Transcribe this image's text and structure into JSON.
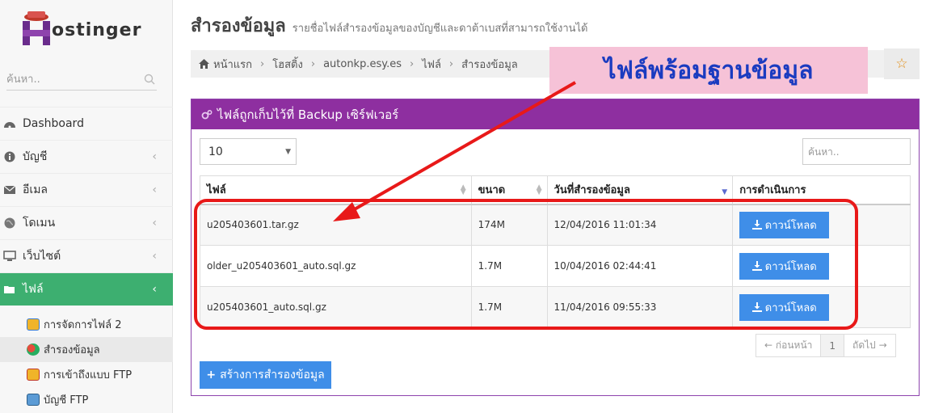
{
  "brand": {
    "name": "ostinger"
  },
  "sidebar": {
    "search_placeholder": "ค้นหา..",
    "items": [
      {
        "label": "Dashboard",
        "icon": "dashboard-icon"
      },
      {
        "label": "บัญชี",
        "icon": "info-icon"
      },
      {
        "label": "อีเมล",
        "icon": "envelope-icon"
      },
      {
        "label": "โดเมน",
        "icon": "globe-icon"
      },
      {
        "label": "เว็บไซต์",
        "icon": "monitor-icon"
      },
      {
        "label": "ไฟล์",
        "icon": "folder-icon"
      }
    ],
    "subitems": [
      {
        "label": "การจัดการไฟล์ 2"
      },
      {
        "label": "สำรองข้อมูล"
      },
      {
        "label": "การเข้าถึงแบบ FTP"
      },
      {
        "label": "บัญชี FTP"
      }
    ]
  },
  "page": {
    "title": "สำรองข้อมูล",
    "subtitle": "รายชื่อไฟล์สำรองข้อมูลของบัญชีและดาต้าเบสที่สามารถใช้งานได้"
  },
  "breadcrumb": [
    "หน้าแรก",
    "โฮสติ้ง",
    "autonkp.esy.es",
    "ไฟล์",
    "สำรองข้อมูล"
  ],
  "annotation": {
    "text": "ไฟล์พร้อมฐานข้อมูล"
  },
  "panel": {
    "title": "ไฟล์ถูกเก็บไว้ที่ Backup เซิร์ฟเวอร์",
    "page_length": "10",
    "search_placeholder": "ค้นหา..",
    "columns": [
      "ไฟล์",
      "ขนาด",
      "วันที่สำรองข้อมูล",
      "การดำเนินการ"
    ],
    "rows": [
      {
        "file": "u205403601.tar.gz",
        "size": "174M",
        "date": "12/04/2016 11:01:34",
        "action": "ดาวน์โหลด"
      },
      {
        "file": "older_u205403601_auto.sql.gz",
        "size": "1.7M",
        "date": "10/04/2016 02:44:41",
        "action": "ดาวน์โหลด"
      },
      {
        "file": "u205403601_auto.sql.gz",
        "size": "1.7M",
        "date": "11/04/2016 09:55:33",
        "action": "ดาวน์โหลด"
      }
    ],
    "pager": {
      "prev": "← ก่อนหน้า",
      "page": "1",
      "next": "ถัดไป →"
    },
    "create_label": "สร้างการสำรองข้อมูล"
  },
  "colors": {
    "accent_purple": "#8e2fa0",
    "active_green": "#3daf70",
    "button_blue": "#3f8ee8",
    "highlight_red": "#e81919"
  }
}
